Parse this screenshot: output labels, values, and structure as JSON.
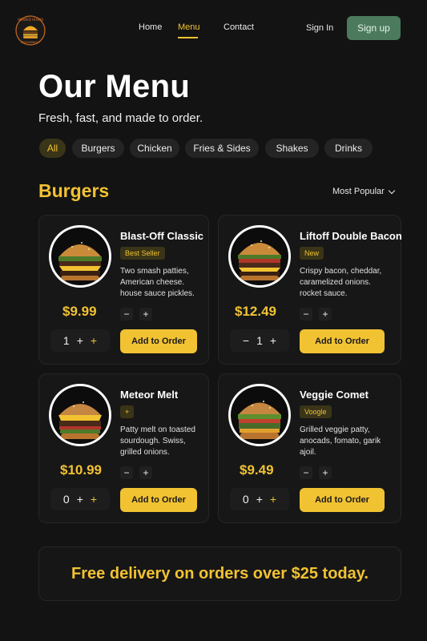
{
  "brand": {
    "logo_text": "HOWIED HUSHS",
    "logo_text_bottom": "ZYDUUMINOUT"
  },
  "nav": {
    "home": "Home",
    "menu": "Menu",
    "contact": "Contact",
    "sign_in": "Sign In",
    "sign_up": "Sign up"
  },
  "hero": {
    "title": "Our Menu",
    "subtitle": "Fresh, fast, and made to order."
  },
  "filters": [
    "All",
    "Burgers",
    "Chicken",
    "Fries & Sides",
    "Shakes",
    "Drinks"
  ],
  "section": {
    "title": "Burgers",
    "sort_label": "Most Popular"
  },
  "items": [
    {
      "name": "Blast-Off Classic",
      "badge": "Best Seller",
      "desc": "Two smash patties, American cheese. house sauce pickles.",
      "price": "$9.99",
      "qty": "1",
      "mini_minus": "−",
      "mini_plus": "+",
      "qty_minus": "",
      "qty_plus": "+",
      "add_label": "Add to Order"
    },
    {
      "name": "Liftoff Double Bacon",
      "badge": "New",
      "desc": "Crispy bacon, cheddar, caramelized onions. rocket sauce.",
      "price": "$12.49",
      "qty": "1",
      "mini_minus": "−",
      "mini_plus": "+",
      "qty_minus": "−",
      "qty_plus": "+",
      "add_label": "Add to Order"
    },
    {
      "name": "Meteor Melt",
      "badge": "+",
      "desc": "Patty melt on toasted sourdough. Swiss, grilled onions.",
      "price": "$10.99",
      "qty": "0",
      "mini_minus": "−",
      "mini_plus": "+",
      "qty_minus": "",
      "qty_plus": "+",
      "add_label": "Add to Order"
    },
    {
      "name": "Veggie Comet",
      "badge": "Voogle",
      "desc": "Grilled veggie patty, anocads, fomato, garik ajoil.",
      "price": "$9.49",
      "qty": "0",
      "mini_minus": "−",
      "mini_plus": "+",
      "qty_minus": "",
      "qty_plus": "+",
      "add_label": "Add to Order"
    }
  ],
  "banner": {
    "text": "Free delivery on orders over $25 today."
  },
  "colors": {
    "accent": "#f1c232",
    "background": "#131313",
    "card": "#171717",
    "signup": "#4b7a5d"
  }
}
